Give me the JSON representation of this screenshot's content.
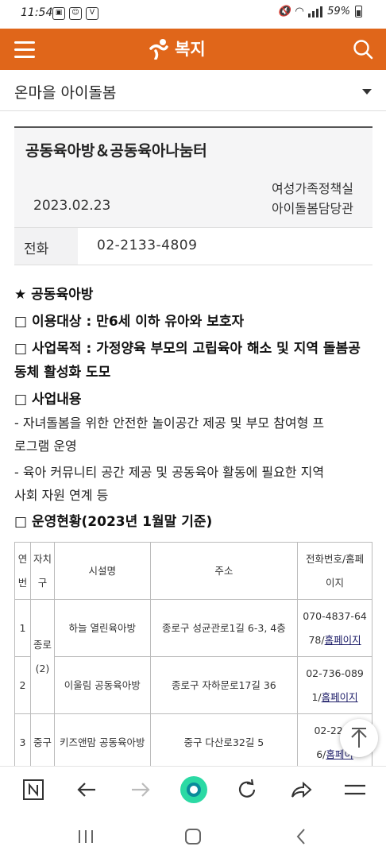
{
  "status_bar": {
    "time": "11:54",
    "battery": "59%"
  },
  "header": {
    "title": "복지",
    "menu_icon": "hamburger-icon",
    "search_icon": "search-icon",
    "logo_icon": "seoul-logo-icon"
  },
  "category": {
    "label": "온마을 아이돌봄"
  },
  "article": {
    "title": "공동육아방＆공동육아나눔터",
    "date": "2023.02.23",
    "dept_line1": "여성가족정책실",
    "dept_line2": "아이돌봄담당관",
    "phone_label": "전화",
    "phone_value": "02-2133-4809"
  },
  "body": {
    "heading": "★ 공동육아방",
    "target": "□ 이용대상 : 만6세 이하 유아와 보호자",
    "purpose_1": "□ 사업목적 : 가정양육 부모의 고립육아 해소 및 지역 돌봄공",
    "purpose_2": "동체 활성화 도모",
    "content_heading": "□ 사업내용",
    "item1_1": "- 자녀돌봄을 위한 안전한 놀이공간 제공 및 부모 참여형 프",
    "item1_2": "로그램 운영",
    "item2_1": "- 육아 커뮤니티 공간 제공 및 공동육아 활동에 필요한 지역",
    "item2_2": "사회 자원 연계 등",
    "status_heading": "□ 운영현황(2023년 1월말 기준)"
  },
  "table": {
    "headers": {
      "no_1": "연",
      "no_2": "번",
      "gu_1": "자치",
      "gu_2": "구",
      "name": "시설명",
      "address": "주소",
      "phone_1": "전화번호/홈페",
      "phone_2": "이지"
    },
    "rows": [
      {
        "no": "1",
        "name": "하늘 열린육아방",
        "address": "종로구 성균관로1길 6-3, 4층",
        "phone_1": "070-4837-64",
        "phone_2": "78/",
        "link": "홈페이지"
      },
      {
        "no": "2",
        "name": "이울림 공동육아방",
        "address": "종로구 자하문로17길 36",
        "phone_1": "02-736-089",
        "phone_2": "1/",
        "link": "홈페이지"
      },
      {
        "no": "3",
        "name": "키즈앤맘 공동육아방",
        "address": "중구 다산로32길 5",
        "phone_1": "02-2263",
        "phone_2": "6/",
        "link": "홈페이"
      }
    ],
    "gu_jongno": "종로",
    "gu_jongno_count": "(2)",
    "gu_junggu": "중구"
  },
  "colors": {
    "brand": "#e0661a",
    "accent_green": "#2bd9a4"
  }
}
